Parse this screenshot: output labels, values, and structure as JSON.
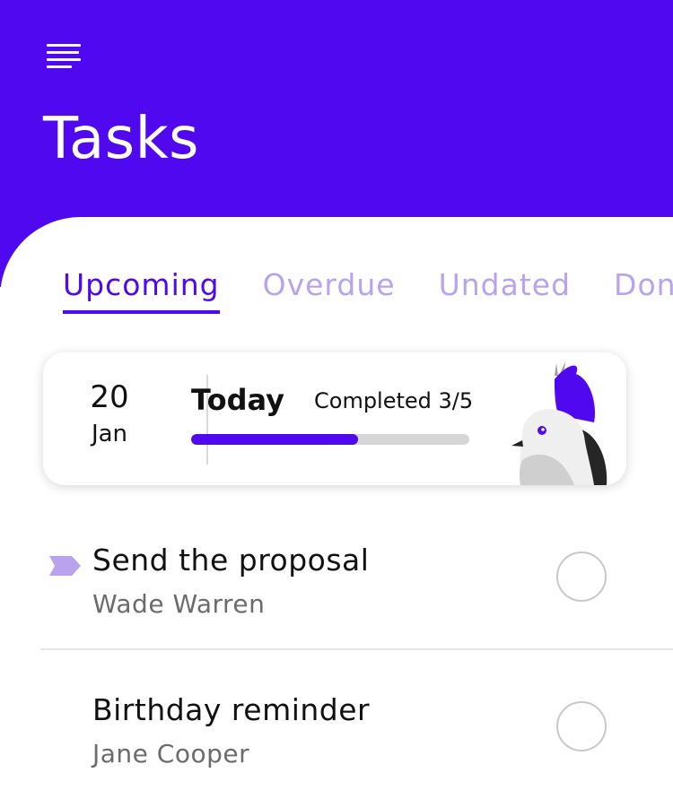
{
  "header": {
    "title": "Tasks",
    "menu_icon": "hamburger-menu-icon",
    "background": "#5008ef"
  },
  "tabs": [
    {
      "label": "Upcoming",
      "active": true
    },
    {
      "label": "Overdue",
      "active": false
    },
    {
      "label": "Undated",
      "active": false
    },
    {
      "label": "Done",
      "active": false
    }
  ],
  "summary": {
    "day": "20",
    "month": "Jan",
    "label": "Today",
    "completed_text": "Completed 3/5",
    "progress": 0.6,
    "illustration": "bird-illustration"
  },
  "tasks": [
    {
      "title": "Send the proposal",
      "assignee": "Wade Warren",
      "tagged": true,
      "tag_color": "#b9a3ee",
      "done": false
    },
    {
      "title": "Birthday reminder",
      "assignee": "Jane Cooper",
      "tagged": false,
      "done": false
    }
  ],
  "colors": {
    "accent": "#5008ef",
    "tab_inactive": "#b9a3ee",
    "progress_track": "#d6d6d6"
  }
}
